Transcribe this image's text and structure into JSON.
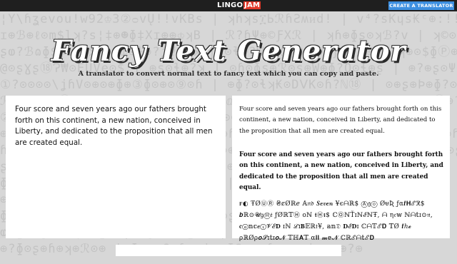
{
  "header": {
    "logo_left": "LINGO",
    "logo_right": "JAM",
    "create_button_label": "CREATE A TRANSLATOR"
  },
  "hero": {
    "title": "Fancy Text Generator",
    "subtitle": "A translator to convert normal text to fancy text which you can copy and paste."
  },
  "input": {
    "value": "Four score and seven years ago our fathers brought forth on this continent, a new nation, conceived in Liberty, and dedicated to the proposition that all men are created equal."
  },
  "outputs": {
    "typewriter": "Four score and seven years ago our fathers brought forth on this continent, a new nation, conceived in Liberty, and dedicated to the proposition that all men are created equal.",
    "bold_script": "Four score and seven years ago our fathers brought forth on this continent, a new nation, conceived in Liberty, and dedicated to the proposition that all men are created equal.",
    "mixed_fancy": "ғ◐ ŦØⓊⓇ ₴ȼØℝ𝑒 𝔸𝔫𝔡 𝑺𝒆𝒗𝒆𝒏 ¥єᗩℝ$ Ⓐ𝔤ⓞ ØᵾƦ ƒα𝒕𝐇ℰℜ$ 𝒃ℝ⊙𝓤𝗀Ⓗ𝔱 ƒØℝ𝕋Ⓗ ᴏℕ 𝖙Ⓗᵻ$ ℂⓄℕŤɪℕℰℕŦ, ᗩ η𝔢𝕨 ℕᗩ𝕥ɪ⊙𝔫, 𝐜ⓞ𝕟𝕔𝒆ⓘ𝓥ℰ𝐃 ɪℕ ℒɪ𝐁𝔼ℝ𝔱¥, 𝕒𝕟𝔇 𝐃ℰ𝐃ɪ ℂᗩ𝕋ℰ𝐃 𝕋Ø 𝒕ℎ𝓮 ρℝØρ𝒐𝓢ɪ𝕥ɪ𝒐𝓝 𝕋ℍ𝐀𝕋 α𝐥𝐥 𝓶𝕖𝓝 ℂℝℰᗩ𝕥ℰ𝐃"
  },
  "bottom_field": {
    "value": ""
  }
}
